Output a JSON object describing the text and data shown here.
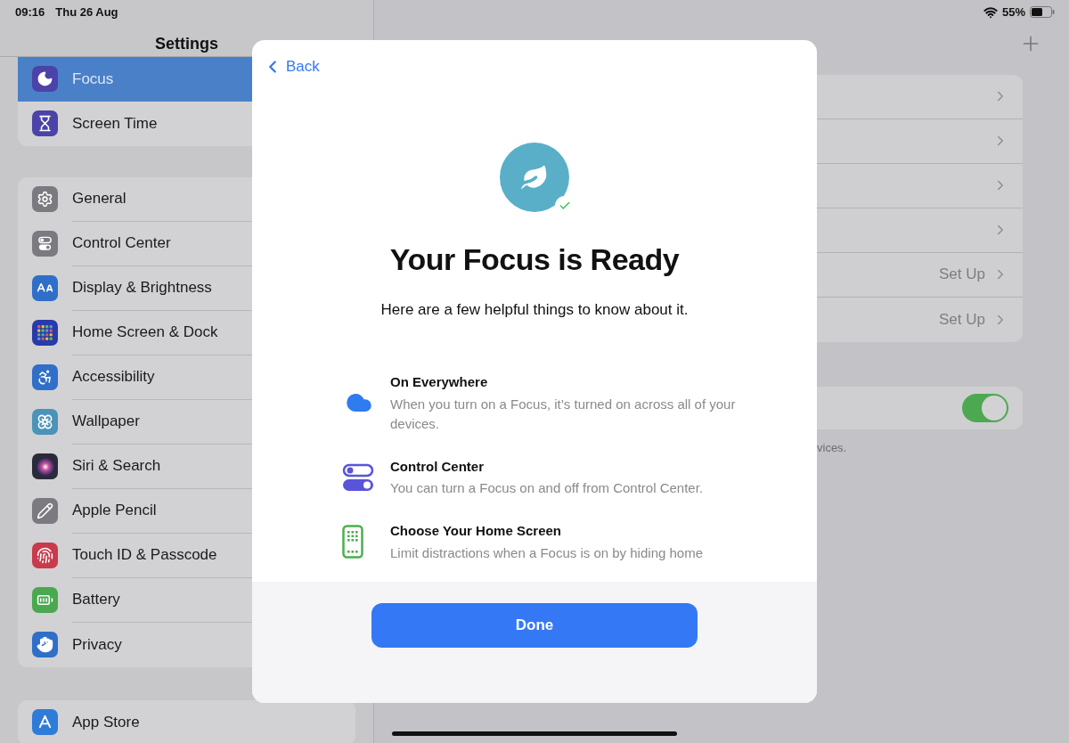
{
  "status_bar": {
    "time": "09:16",
    "date": "Thu 26 Aug",
    "battery": "55%"
  },
  "sidebar": {
    "title": "Settings",
    "groups": [
      [
        {
          "label": "Focus",
          "selected": true
        },
        {
          "label": "Screen Time",
          "selected": false
        }
      ],
      [
        {
          "label": "General",
          "selected": false
        },
        {
          "label": "Control Center",
          "selected": false
        },
        {
          "label": "Display & Brightness",
          "selected": false
        },
        {
          "label": "Home Screen & Dock",
          "selected": false
        },
        {
          "label": "Accessibility",
          "selected": false
        },
        {
          "label": "Wallpaper",
          "selected": false
        },
        {
          "label": "Siri & Search",
          "selected": false
        },
        {
          "label": "Apple Pencil",
          "selected": false
        },
        {
          "label": "Touch ID & Passcode",
          "selected": false
        },
        {
          "label": "Battery",
          "selected": false
        },
        {
          "label": "Privacy",
          "selected": false
        }
      ],
      [
        {
          "label": "App Store",
          "selected": false
        }
      ]
    ]
  },
  "detail": {
    "rows": [
      {},
      {},
      {},
      {},
      {
        "value": "Set Up"
      },
      {
        "value": "Set Up"
      }
    ],
    "toggle": {
      "on": true
    },
    "footnote": "vices."
  },
  "modal": {
    "back": "Back",
    "title": "Your Focus is Ready",
    "subtitle": "Here are a few helpful things to know about it.",
    "features": [
      {
        "title": "On Everywhere",
        "description": "When you turn on a Focus, it’s turned on across all of your devices."
      },
      {
        "title": "Control Center",
        "description": "You can turn a Focus on and off from Control Center."
      },
      {
        "title": "Choose Your Home Screen",
        "description": "Limit distractions when a Focus is on by hiding home"
      }
    ],
    "done": "Done"
  }
}
